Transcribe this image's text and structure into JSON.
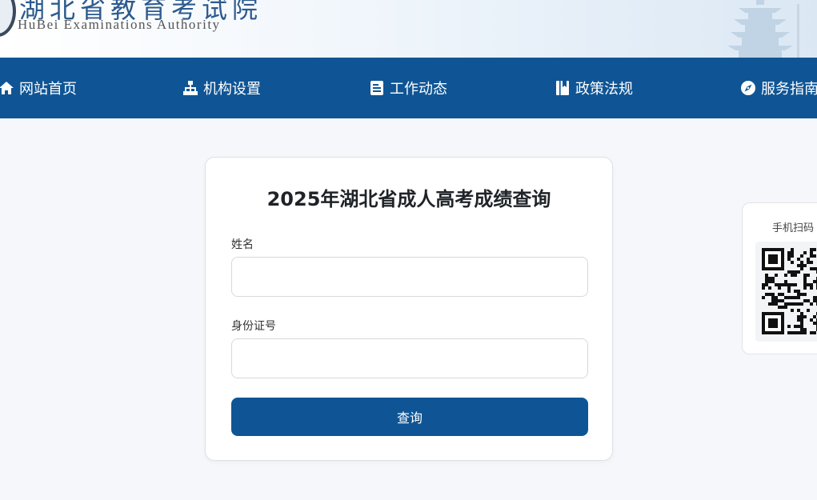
{
  "header": {
    "title_cn": "湖北省教育考试院",
    "title_en": "HuBei Examinations Authority"
  },
  "nav": {
    "items": [
      {
        "label": "网站首页",
        "icon": "home-icon"
      },
      {
        "label": "机构设置",
        "icon": "sitemap-icon"
      },
      {
        "label": "工作动态",
        "icon": "document-icon"
      },
      {
        "label": "政策法规",
        "icon": "book-icon"
      },
      {
        "label": "服务指南",
        "icon": "compass-icon"
      }
    ]
  },
  "form": {
    "title": "2025年湖北省成人高考成绩查询",
    "name_label": "姓名",
    "name_value": "",
    "id_label": "身份证号",
    "id_value": "",
    "submit_label": "查询"
  },
  "qr": {
    "label": "手机扫码"
  },
  "colors": {
    "nav_bg": "#0f5595",
    "button_bg": "#0f5595",
    "page_bg": "#f5f7fa"
  }
}
